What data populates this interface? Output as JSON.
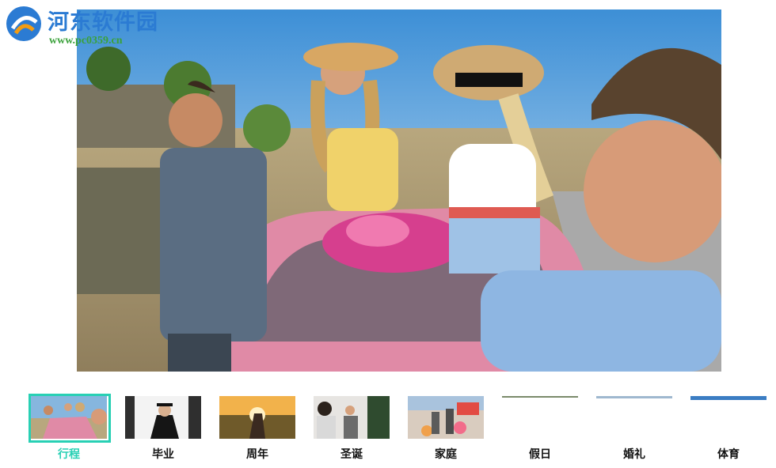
{
  "watermark": {
    "title": "河东软件园",
    "url": "www.pc0359.cn"
  },
  "thumbnails": [
    {
      "label": "行程",
      "active": true
    },
    {
      "label": "毕业",
      "active": false
    },
    {
      "label": "周年",
      "active": false
    },
    {
      "label": "圣诞",
      "active": false
    },
    {
      "label": "家庭",
      "active": false
    },
    {
      "label": "假日",
      "active": false
    },
    {
      "label": "婚礼",
      "active": false
    },
    {
      "label": "体育",
      "active": false
    }
  ],
  "colors": {
    "accent": "#28d0b4",
    "watermark_title": "#2b7bd3",
    "watermark_url": "#3aa13a"
  }
}
